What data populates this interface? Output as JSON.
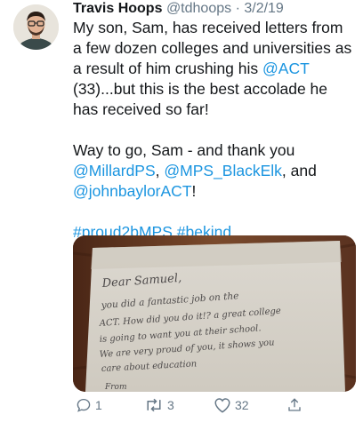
{
  "tweet": {
    "author_name": "Travis Hoops",
    "author_handle": "@tdhoops",
    "separator": " · ",
    "date": "3/2/19",
    "body": {
      "p1_part1": "My son, Sam, has received letters from a few dozen colleges and universities as a result of him crushing his ",
      "p1_mention": "@ACT",
      "p1_part2": " (33)...but this is the best accolade he has received so far!",
      "p2_part1": "Way to go, Sam - and thank you ",
      "p2_mention1": "@MillardPS",
      "p2_sep1": ", ",
      "p2_mention2": "@MPS_BlackElk",
      "p2_sep2": ", and ",
      "p2_mention3": "@johnbaylorACT",
      "p2_end": "!",
      "hashtag1": "#proud2bMPS",
      "hashtag_sep": " ",
      "hashtag2": "#bekind"
    },
    "photo": {
      "note_lines": [
        "Dear Samuel,",
        "you did a fantastic job on the",
        "ACT. How did you do it!? a great college",
        "is going to want you at their school.",
        "We are very proud of you, it shows you",
        "care about education",
        "From"
      ]
    },
    "actions": {
      "reply_count": "1",
      "retweet_count": "3",
      "like_count": "32"
    }
  }
}
